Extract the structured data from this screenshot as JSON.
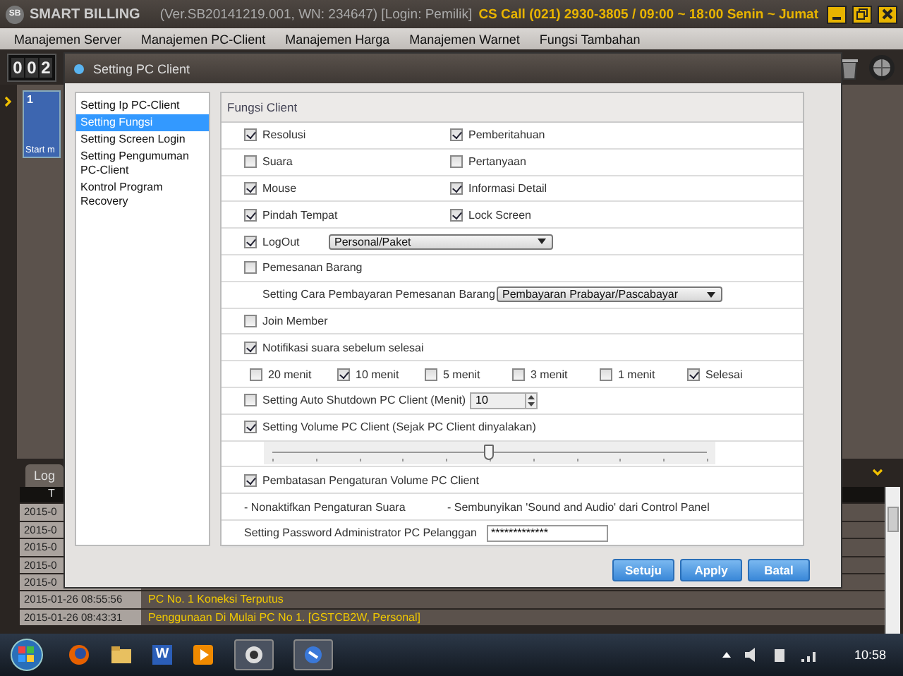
{
  "app": {
    "logo_badge": "SB",
    "title": "SMART BILLING",
    "version": "(Ver.SB20141219.001, WN: 234647) [Login: Pemilik]",
    "cs_call": "CS Call (021) 2930-3805 / 09:00 ~ 18:00 Senin ~ Jumat"
  },
  "menu": [
    "Manajemen Server",
    "Manajemen PC-Client",
    "Manajemen Harga",
    "Manajemen Warnet",
    "Fungsi Tambahan"
  ],
  "counter_digits": [
    "0",
    "0",
    "2"
  ],
  "pc_tile": {
    "number": "1",
    "caption": "Start m"
  },
  "log_tab": "Log",
  "log_header": "T",
  "log_rows": [
    {
      "date": "2015-0"
    },
    {
      "date": "2015-0"
    },
    {
      "date": "2015-0"
    },
    {
      "date": "2015-0"
    },
    {
      "date": "2015-0"
    },
    {
      "date": "2015-01-26 08:55:56",
      "message": "PC No. 1 Koneksi Terputus"
    },
    {
      "date": "2015-01-26 08:43:31",
      "message": "Penggunaan Di Mulai PC No 1. [GSTCB2W, Personal]"
    }
  ],
  "dialog": {
    "title": "Setting PC Client",
    "nav": [
      {
        "label": "Setting Ip PC-Client",
        "selected": false
      },
      {
        "label": "Setting Fungsi",
        "selected": true
      },
      {
        "label": "Setting Screen Login",
        "selected": false
      },
      {
        "label": "Setting Pengumuman PC-Client",
        "selected": false
      },
      {
        "label": "Kontrol Program Recovery",
        "selected": false
      }
    ],
    "section": "Fungsi Client",
    "rows": [
      {
        "kind": "pair",
        "items": [
          {
            "label": "Resolusi",
            "checked": true
          },
          {
            "label": "Pemberitahuan",
            "checked": true
          }
        ]
      },
      {
        "kind": "pair",
        "items": [
          {
            "label": "Suara",
            "checked": false
          },
          {
            "label": "Pertanyaan",
            "checked": false
          }
        ]
      },
      {
        "kind": "pair",
        "items": [
          {
            "label": "Mouse",
            "checked": true
          },
          {
            "label": "Informasi Detail",
            "checked": true
          }
        ]
      },
      {
        "kind": "pair",
        "items": [
          {
            "label": "Pindah Tempat",
            "checked": true
          },
          {
            "label": "Lock Screen",
            "checked": true
          }
        ]
      },
      {
        "kind": "check_select",
        "label": "LogOut",
        "checked": true,
        "value": "Personal/Paket"
      },
      {
        "kind": "check",
        "label": "Pemesanan Barang",
        "checked": false
      },
      {
        "kind": "label_select",
        "label": "Setting Cara Pembayaran Pemesanan Barang",
        "value": "Pembayaran Prabayar/Pascabayar"
      },
      {
        "kind": "check",
        "label": "Join Member",
        "checked": false
      },
      {
        "kind": "check",
        "label": "Notifikasi suara sebelum selesai",
        "checked": true
      },
      {
        "kind": "options",
        "items": [
          {
            "label": "20 menit",
            "checked": false
          },
          {
            "label": "10 menit",
            "checked": true
          },
          {
            "label": "5 menit",
            "checked": false
          },
          {
            "label": "3 menit",
            "checked": false
          },
          {
            "label": "1 menit",
            "checked": false
          },
          {
            "label": "Selesai",
            "checked": true
          }
        ]
      },
      {
        "kind": "check_spin",
        "label": "Setting Auto Shutdown PC Client (Menit)",
        "checked": false,
        "value": "10"
      },
      {
        "kind": "check",
        "label": "Setting Volume PC Client (Sejak PC Client dinyalakan)",
        "checked": true
      },
      {
        "kind": "slider",
        "level": 0.5
      },
      {
        "kind": "check",
        "label": "Pembatasan Pengaturan Volume PC Client",
        "checked": true
      },
      {
        "kind": "notes",
        "items": [
          "- Nonaktifkan Pengaturan Suara",
          "- Sembunyikan 'Sound and Audio' dari Control Panel"
        ]
      },
      {
        "kind": "password",
        "label": "Setting Password Administrator PC Pelanggan",
        "value": "*************"
      }
    ],
    "buttons": [
      "Setuju",
      "Apply",
      "Batal"
    ]
  },
  "taskbar": {
    "word_label": "W",
    "time": "10:58"
  }
}
